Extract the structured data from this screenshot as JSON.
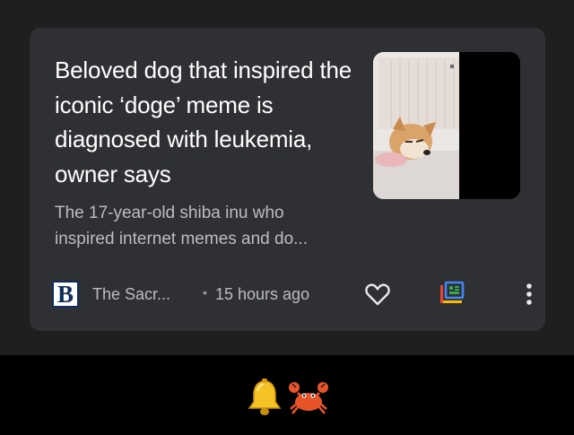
{
  "card": {
    "headline": "Beloved dog that inspired the iconic ‘doge’ meme is diagnosed with leukemia, owner says",
    "snippet": "The 17-year-old shiba inu who inspired internet memes and do...",
    "thumbnail_icon": "dog-photo-thumbnail"
  },
  "meta": {
    "publisher_logo_letter": "B",
    "publisher_name": "The Sacr...",
    "separator": "•",
    "time": "15 hours ago"
  },
  "actions": {
    "like_icon": "heart-outline-icon",
    "full_coverage_icon": "full-coverage-icon",
    "more_icon": "more-vertical-icon"
  },
  "bottom_bar": {
    "emojis": [
      "bell-icon",
      "crab-icon"
    ]
  },
  "colors": {
    "background": "#1f1f20",
    "card": "#2f3033",
    "headline": "#ffffff",
    "secondary_text": "#bcbdc0",
    "publisher_logo": "#0e2d5c",
    "full_coverage_blue": "#4285f4",
    "full_coverage_yellow": "#fbbc04",
    "full_coverage_green": "#34a853",
    "full_coverage_red": "#ea4335"
  }
}
